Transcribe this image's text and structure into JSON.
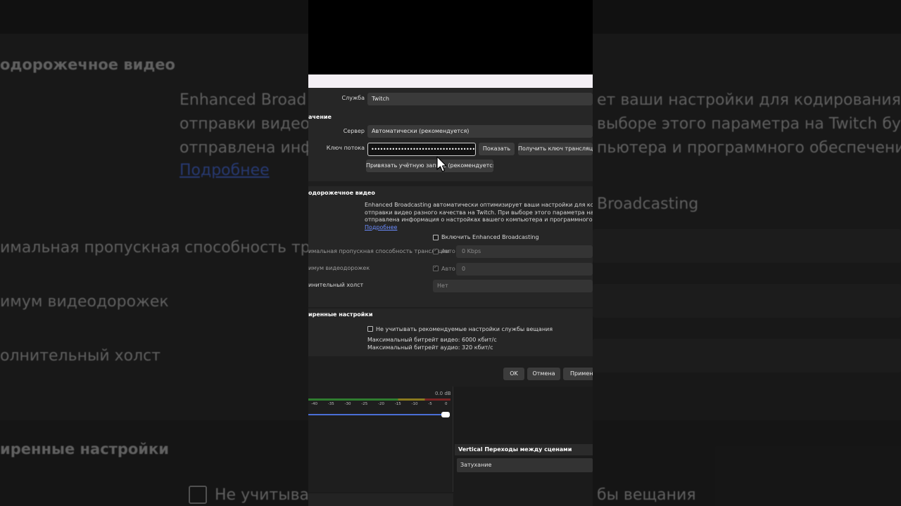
{
  "background": {
    "heading_video": "одорожечное видео",
    "desc_line1_a": "Enhanced Broad",
    "desc_line1_b": "ет ваши настройки для кодирования и",
    "desc_line2_a": "отправки видео",
    "desc_line2_b": "выборе этого параметра на Twitch будет",
    "desc_line3_a": "отправлена инф",
    "desc_line3_b": "пьютера и программного обеспечени",
    "learn_more": "Подробнее",
    "enhanced_tail": "Broadcasting",
    "bandwidth_label": "имальная пропускная способность тр",
    "tracks_label": "имум видеодорожек",
    "canvas_label": "олнительный холст",
    "advanced_heading": "иренные настройки",
    "ignore_a": "Не учитыва",
    "ignore_b": "бы вещания"
  },
  "dialog": {
    "service_label": "Служба",
    "service_value": "Twitch",
    "section_destination": "ачение",
    "server_label": "Сервер",
    "server_value": "Автоматически (рекомендуется)",
    "stream_key_label": "Ключ потока",
    "stream_key_masked": "••••••••••••••••••••••••••••••••••••",
    "show_button": "Показать",
    "get_key_button": "Получить ключ трансляции",
    "connect_account_button": "Привязать учётную запись (рекомендуется)",
    "section_video": "одорожечное видео",
    "desc_line1": "Enhanced Broadcasting автоматически оптимизирует ваши настройки для кодирования и",
    "desc_line2": "отправки видео разного качества на Twitch. При выборе этого параметра на Twitch будет",
    "desc_line3": "отправлена информация о настройках вашего компьютера и программного обеспечения",
    "learn_more": "Подробнее",
    "enable_enhanced": "Включить Enhanced Broadcasting",
    "bandwidth_label": "имальная пропускная способность трансляции",
    "auto_label_1": "Авто",
    "bandwidth_value": "0 Kbps",
    "tracks_label": "имум видеодорожек",
    "auto_label_2": "Авто",
    "tracks_value": "0",
    "canvas_label": "инительный холст",
    "canvas_value": "Нет",
    "section_advanced": "иренные настройки",
    "ignore_recommended": "Не учитывать рекомендуемые настройки службы вещания",
    "max_video_bitrate": "Максимальный битрейт видео: 6000 кбит/с",
    "max_audio_bitrate": "Максимальный битрейт аудио: 320 кбит/с",
    "ok_button": "OK",
    "cancel_button": "Отмена",
    "apply_button": "Применить"
  },
  "obs": {
    "db_readout": "0.0 dB",
    "ticks": [
      "-40",
      "-35",
      "-30",
      "-25",
      "-20",
      "-15",
      "-10",
      "-5",
      "0"
    ],
    "fader_level": 0.97,
    "transitions_header": "Vertical Переходы между сценами",
    "fade_item": "Затухание"
  }
}
